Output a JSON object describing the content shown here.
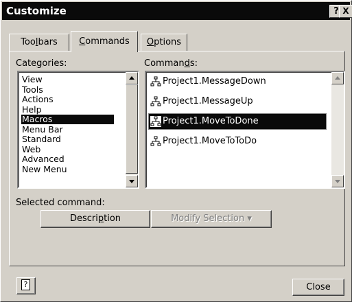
{
  "window": {
    "title": "Customize",
    "help_btn": "?",
    "close_btn": "X"
  },
  "tabs": [
    {
      "label": "Toolbars",
      "active": false
    },
    {
      "label": "Commands",
      "active": true
    },
    {
      "label": "Options",
      "active": false
    }
  ],
  "categories": {
    "label": "Categories:",
    "items": [
      "View",
      "Tools",
      "Actions",
      "Help",
      "Macros",
      "Menu Bar",
      "Standard",
      "Web",
      "Advanced",
      "New Menu"
    ],
    "selected": "Macros"
  },
  "commands": {
    "label": "Commands:",
    "items": [
      "Project1.MessageDown",
      "Project1.MessageUp",
      "Project1.MoveToDone",
      "Project1.MoveToToDo"
    ],
    "selected": "Project1.MoveToDone"
  },
  "selected_command": {
    "label": "Selected command:",
    "description_button": "Description",
    "modify_button": "Modify Selection",
    "modify_arrow": "▾"
  },
  "footer": {
    "help_icon": "?",
    "close_button": "Close"
  }
}
